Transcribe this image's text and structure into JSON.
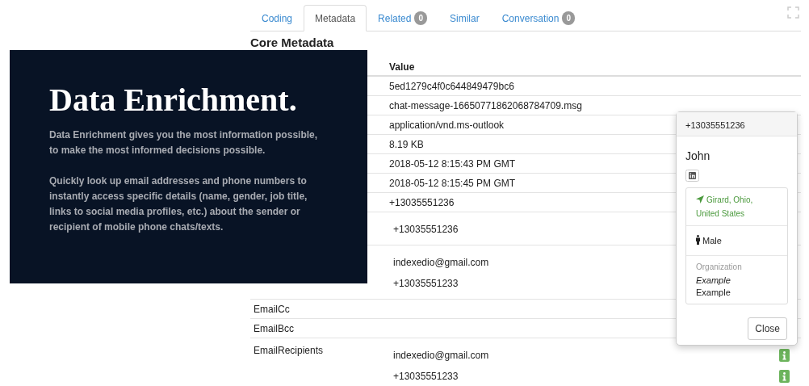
{
  "tabs": [
    {
      "label": "Coding",
      "selected": false
    },
    {
      "label": "Metadata",
      "selected": true
    },
    {
      "label": "Related",
      "selected": false,
      "count": "0"
    },
    {
      "label": "Similar",
      "selected": false
    },
    {
      "label": "Conversation",
      "selected": false,
      "count": "0"
    }
  ],
  "section_title": "Core Metadata",
  "table": {
    "columns": [
      {
        "label": "Value"
      }
    ],
    "rows": [
      {
        "kind": "plain",
        "values": [
          {
            "text": "5ed1279c4f0c644849479bc6"
          }
        ]
      },
      {
        "kind": "plain",
        "values": [
          {
            "text": "chat-message-16650771862068784709.msg"
          }
        ]
      },
      {
        "kind": "plain",
        "values": [
          {
            "text": "application/vnd.ms-outlook"
          }
        ]
      },
      {
        "kind": "plain",
        "values": [
          {
            "text": "8.19 KB"
          }
        ]
      },
      {
        "kind": "plain",
        "values": [
          {
            "text": "2018-05-12 8:15:43 PM GMT"
          }
        ]
      },
      {
        "kind": "plain",
        "values": [
          {
            "text": "2018-05-12 8:15:45 PM GMT"
          }
        ]
      },
      {
        "kind": "plain",
        "values": [
          {
            "text": "+13035551236"
          }
        ]
      },
      {
        "kind": "list",
        "values": [
          {
            "text": "+13035551236"
          }
        ]
      },
      {
        "kind": "list",
        "values": [
          {
            "text": "indexedio@gmail.com"
          },
          {
            "text": "+13035551233"
          }
        ]
      },
      {
        "kind": "plain",
        "name": "EmailCc"
      },
      {
        "kind": "plain",
        "name": "EmailBcc"
      },
      {
        "kind": "list",
        "name": "EmailRecipients",
        "values": [
          {
            "text": "indexedio@gmail.com",
            "info": true
          },
          {
            "text": "+13035551233",
            "info": true
          }
        ]
      }
    ]
  },
  "overlay": {
    "title": "Data Enrichment.",
    "paragraphs": [
      "Data Enrichment gives you the most information possible, to make the most informed decisions possible.",
      "Quickly look up email addresses and phone numbers to instantly access specific details (name, gender, job title, links to social media profiles, etc.) about the sender or recipient of mobile phone chats/texts."
    ]
  },
  "popover": {
    "title": "+13035551236",
    "name": "John",
    "location": "Girard, Ohio, United States",
    "gender": "Male",
    "organization_label": "Organization",
    "organization_title": "Example",
    "organization_name": "Example",
    "close_button": "Close"
  }
}
